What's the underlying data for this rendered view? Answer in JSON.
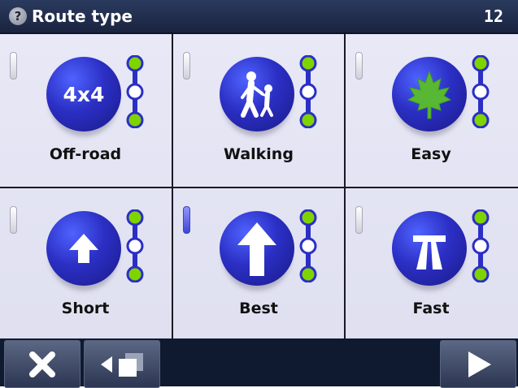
{
  "header": {
    "help_glyph": "?",
    "title": "Route type",
    "count": "12"
  },
  "route_types": [
    {
      "label": "Off-road",
      "icon": "four-by-four-icon",
      "badge_text": "4x4",
      "selected": false
    },
    {
      "label": "Walking",
      "icon": "pedestrian-icon",
      "selected": false
    },
    {
      "label": "Easy",
      "icon": "maple-leaf-icon",
      "selected": false
    },
    {
      "label": "Short",
      "icon": "small-arrow-up-icon",
      "selected": false
    },
    {
      "label": "Best",
      "icon": "large-arrow-up-icon",
      "selected": true
    },
    {
      "label": "Fast",
      "icon": "highway-icon",
      "selected": false
    }
  ],
  "colors": {
    "header_bg": "#1a2440",
    "disc_blue": "#2b2fc4",
    "dot_green": "#7fd400",
    "selected_indicator": "#5a60f0"
  }
}
